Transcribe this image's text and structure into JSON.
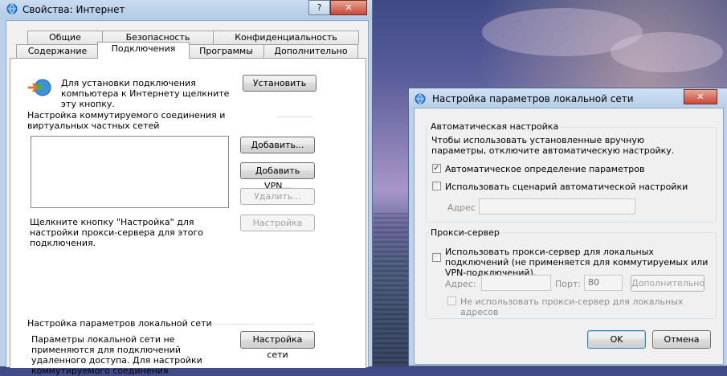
{
  "main_dialog": {
    "title": "Свойства: Интернет",
    "title_buttons": {
      "help": "?",
      "close": "✕"
    },
    "tabs_row1": [
      "Общие",
      "Безопасность",
      "Конфиденциальность"
    ],
    "tabs_row2": [
      "Содержание",
      "Подключения",
      "Программы",
      "Дополнительно"
    ],
    "active_tab": "Подключения",
    "setup_text": "Для установки подключения компьютера к Интернету щелкните эту кнопку.",
    "setup_button": "Установить",
    "dialup_header": "Настройка коммутируемого соединения и виртуальных частных сетей",
    "add_button": "Добавить...",
    "add_vpn_button": "Добавить VPN...",
    "remove_button": "Удалить...",
    "settings_button": "Настройка",
    "proxy_hint": "Щелкните кнопку \"Настройка\" для настройки прокси-сервера для этого подключения.",
    "lan_header": "Настройка параметров локальной сети",
    "lan_text": "Параметры локальной сети не применяются для подключений удаленного доступа. Для настройки коммутируемого соединения",
    "lan_button": "Настройка сети"
  },
  "lan_dialog": {
    "title": "Настройка параметров локальной сети",
    "close": "✕",
    "auto_group": "Автоматическая настройка",
    "auto_desc": "Чтобы использовать установленные вручную параметры, отключите автоматическую настройку.",
    "auto_detect": {
      "label": "Автоматическое определение параметров",
      "checked": true,
      "mark": "✓"
    },
    "auto_script": {
      "label": "Использовать сценарий автоматической настройки",
      "checked": false
    },
    "address_label": "Адрес",
    "address_value": "",
    "proxy_group": "Прокси-сервер",
    "use_proxy": {
      "label": "Использовать прокси-сервер для локальных подключений (не применяется для коммутируемых или VPN-подключений).",
      "checked": false
    },
    "proxy_address_label": "Адрес:",
    "proxy_address_value": "",
    "port_label": "Порт:",
    "port_value": "80",
    "advanced_button": "Дополнительно",
    "bypass_local": {
      "label": "Не использовать прокси-сервер для локальных адресов",
      "checked": false
    },
    "ok_button": "OK",
    "cancel_button": "Отмена"
  },
  "colors": {
    "titlebar": "#b9d1ea",
    "accent_check": "#1c3f78"
  }
}
